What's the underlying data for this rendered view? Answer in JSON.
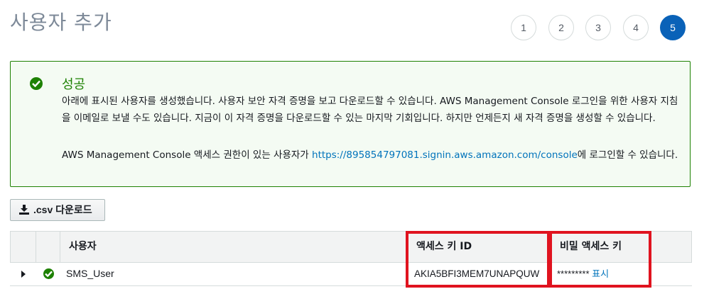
{
  "page": {
    "title": "사용자 추가"
  },
  "steps": [
    "1",
    "2",
    "3",
    "4",
    "5"
  ],
  "active_step": "5",
  "alert": {
    "title": "성공",
    "body": "아래에 표시된 사용자를 생성했습니다. 사용자 보안 자격 증명을 보고 다운로드할 수 있습니다. AWS Management Console 로그인을 위한 사용자 지침을 이메일로 보낼 수도 있습니다. 지금이 이 자격 증명을 다운로드할 수 있는 마지막 기회입니다. 하지만 언제든지 새 자격 증명을 생성할 수 있습니다.",
    "console_prefix": "AWS Management Console 액세스 권한이 있는 사용자가 ",
    "console_url": "https://895854797081.signin.aws.amazon.com/console",
    "console_suffix": "에 로그인할 수 있습니다."
  },
  "download_button": {
    "label": ".csv 다운로드",
    "icon": "download-icon"
  },
  "table": {
    "columns": {
      "user": "사용자",
      "access_key_id": "액세스 키 ID",
      "secret_key": "비밀 액세스 키"
    },
    "rows": [
      {
        "user": "SMS_User",
        "access_key_id": "AKIA5BFI3MEM7UNAPQUW",
        "secret_masked": "*********",
        "show_label": "표시"
      }
    ]
  },
  "colors": {
    "success": "#1d8102",
    "primary": "#0a62b8",
    "link": "#0073bb",
    "highlight": "#e0131f"
  }
}
